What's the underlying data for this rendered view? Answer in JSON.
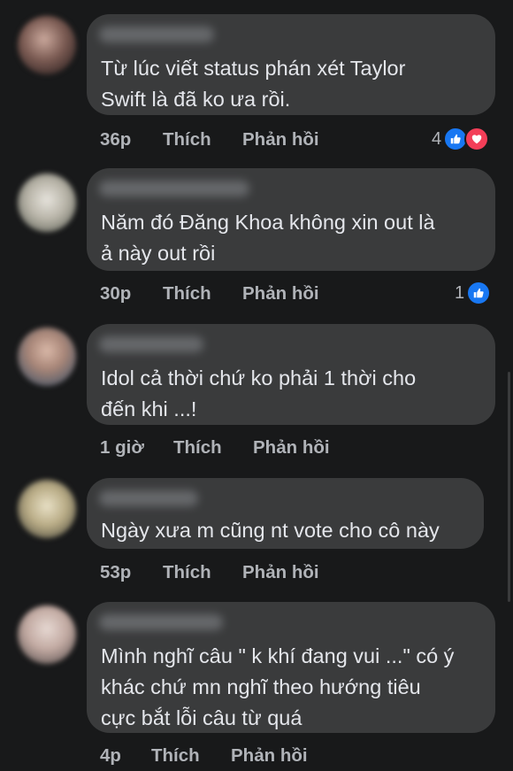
{
  "actions": {
    "like_label": "Thích",
    "reply_label": "Phản hồi"
  },
  "comments": [
    {
      "text_lines": [
        "Từ lúc viết status phán xét Taylor",
        "Swift là đã ko ưa rồi."
      ],
      "time": "36p",
      "reaction_count": "4",
      "reactions": [
        "like-reaction",
        "love-reaction"
      ]
    },
    {
      "text_lines": [
        "Năm đó Đăng Khoa không xin out là",
        "ả này out rồi"
      ],
      "time": "30p",
      "reaction_count": "1",
      "reactions": [
        "like-reaction"
      ]
    },
    {
      "text_lines": [
        "Idol cả thời chứ ko phải 1 thời cho",
        "đến khi ...!"
      ],
      "time": "1 giờ"
    },
    {
      "text_lines": [
        "Ngày xưa m cũng nt vote cho cô này"
      ],
      "time": "53p"
    },
    {
      "text_lines": [
        "Mình nghĩ câu \" k khí đang vui ...\" có ý",
        "khác chứ mn nghĩ theo hướng tiêu",
        "cực bắt lỗi câu từ quá"
      ],
      "time": "4p"
    }
  ],
  "colors": {
    "background": "#18191a",
    "bubble": "#3a3b3c",
    "text": "#e4e6eb",
    "secondary_text": "#b0b3b8",
    "like_blue": "#1877f2",
    "love_red": "#f33e58"
  }
}
